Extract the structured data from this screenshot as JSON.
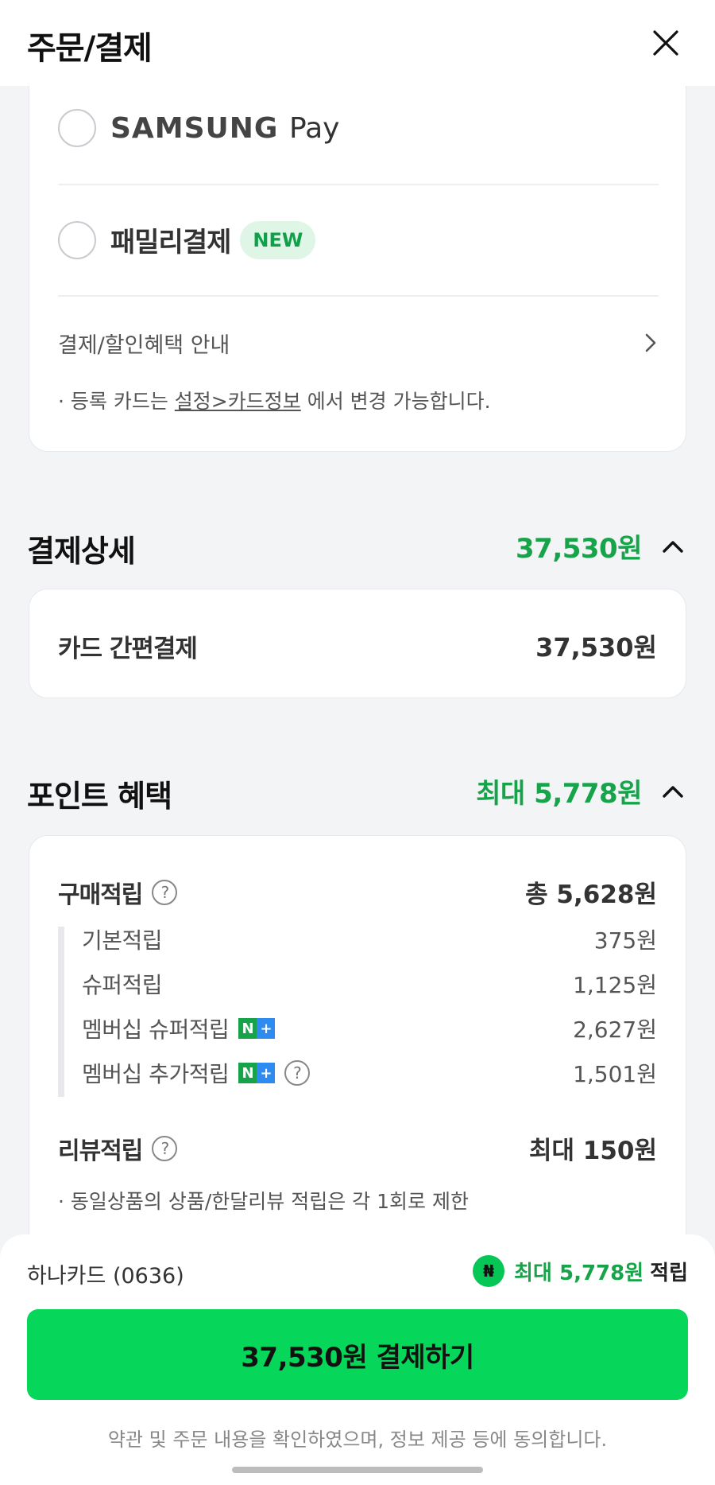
{
  "header": {
    "title": "주문/결제",
    "close_icon": "close-icon"
  },
  "payment_methods": {
    "samsung_pay": {
      "brand": "SAMSUNG",
      "suffix": "Pay"
    },
    "family_pay": {
      "label": "패밀리결제",
      "badge": "NEW"
    },
    "benefit_link": "결제/할인혜택 안내",
    "note_prefix": "· 등록 카드는 ",
    "note_link": "설정>카드정보",
    "note_suffix": " 에서 변경 가능합니다."
  },
  "payment_detail": {
    "title": "결제상세",
    "total": "37,530원",
    "row_label": "카드 간편결제",
    "row_value": "37,530원"
  },
  "point_benefit": {
    "title": "포인트 혜택",
    "total": "최대 5,778원",
    "purchase": {
      "label": "구매적립",
      "value": "총 5,628원"
    },
    "sub_items": [
      {
        "label": "기본적립",
        "value": "375원"
      },
      {
        "label": "슈퍼적립",
        "value": "1,125원"
      },
      {
        "label": "멤버십 슈퍼적립",
        "value": "2,627원"
      },
      {
        "label": "멤버십 추가적립",
        "value": "1,501원"
      }
    ],
    "review": {
      "label": "리뷰적립",
      "value": "최대 150원"
    },
    "review_note": "· 동일상품의 상품/한달리뷰 적립은 각 1회로 제한"
  },
  "bottom": {
    "card_name": "하나카드 (0636)",
    "reward_amount": "최대 5,778원",
    "reward_suffix": "적립",
    "pay_button": "37,530원 결제하기",
    "agreement": "약관 및 주문 내용을 확인하였으며, 정보 제공 등에 동의합니다."
  },
  "colors": {
    "accent_green": "#16a34a",
    "button_green": "#06d65a",
    "background": "#f3f4f6"
  }
}
